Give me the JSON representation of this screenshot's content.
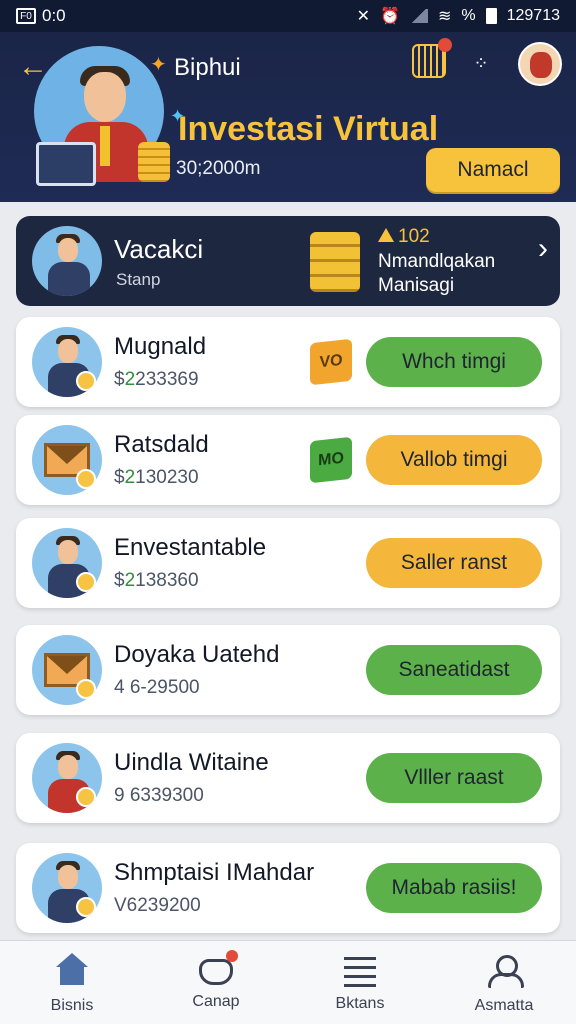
{
  "status_bar": {
    "left_text": "0:0",
    "left_box": "F0",
    "right_text": "129713",
    "percent": "%"
  },
  "header": {
    "subtitle": "Biphui",
    "title": "Investasi Virtual",
    "amount": "30;2000m",
    "button_label": "Namacl",
    "back_icon": "back-arrow-icon",
    "calendar_icon": "calendar-icon",
    "dots_icon": "dots-icon",
    "colors": {
      "background": "#1a2547",
      "accent": "#f7c23c"
    }
  },
  "profile": {
    "name": "Vacakci",
    "sub": "Stanp",
    "count": "102",
    "desc_line1": "Nmandlqakan",
    "desc_line2": "Manisagi"
  },
  "items": [
    {
      "name": "Mugnald",
      "value_prefix": "$",
      "value_green": "2",
      "value_rest": "233369",
      "badge": "VO",
      "action": "Whch timgi"
    },
    {
      "name": "Ratsdald",
      "value_prefix": "$",
      "value_green": "2",
      "value_rest": "130230",
      "badge": "MO",
      "action": "Vallob timgi"
    },
    {
      "name": "Envestantable",
      "value_prefix": "$",
      "value_green": "2",
      "value_rest": "138360",
      "badge": "",
      "action": "Saller ranst"
    },
    {
      "name": "Doyaka Uatehd",
      "value_prefix": "",
      "value_green": "",
      "value_rest": "4 6-29500",
      "badge": "",
      "action": "Saneatidast"
    },
    {
      "name": "Uindla Witaine",
      "value_prefix": "",
      "value_green": "",
      "value_rest": "9 6339300",
      "badge": "",
      "action": "Vlller raast"
    },
    {
      "name": "Shmptaisi IMahdar",
      "value_prefix": "",
      "value_green": "",
      "value_rest": "V6239200",
      "badge": "",
      "action": "Mabab rasiis!"
    }
  ],
  "nav": [
    {
      "label": "Bisnis",
      "icon": "home-icon"
    },
    {
      "label": "Canap",
      "icon": "cart-icon"
    },
    {
      "label": "Bktans",
      "icon": "list-icon"
    },
    {
      "label": "Asmatta",
      "icon": "user-icon"
    }
  ]
}
